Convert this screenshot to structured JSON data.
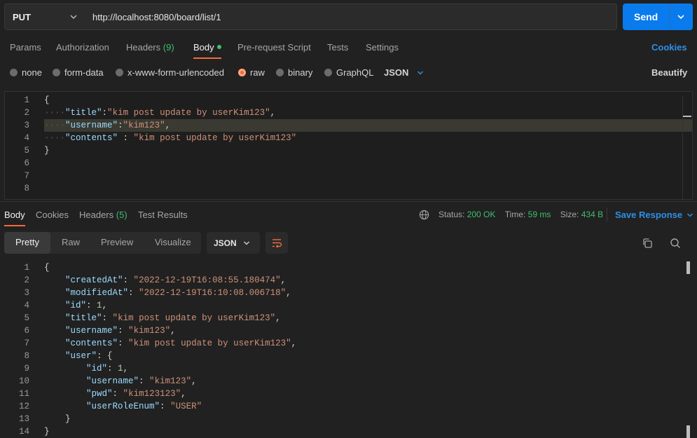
{
  "request": {
    "method": "PUT",
    "url": "http://localhost:8080/board/list/1",
    "send_label": "Send"
  },
  "request_tabs": {
    "params": "Params",
    "authorization": "Authorization",
    "headers": "Headers",
    "headers_count": "(9)",
    "body": "Body",
    "prerequest": "Pre-request Script",
    "tests": "Tests",
    "settings": "Settings",
    "cookies": "Cookies"
  },
  "body_modes": {
    "none": "none",
    "form_data": "form-data",
    "urlencoded": "x-www-form-urlencoded",
    "raw": "raw",
    "binary": "binary",
    "graphql": "GraphQL",
    "format": "JSON",
    "beautify": "Beautify"
  },
  "request_body": {
    "line_numbers": [
      "1",
      "2",
      "3",
      "4",
      "5",
      "6",
      "7",
      "8"
    ],
    "title_value": "kim post update by userKim123",
    "username_value": "kim123",
    "contents_value": "kim post update by userKim123"
  },
  "response_tabs": {
    "body": "Body",
    "cookies": "Cookies",
    "headers": "Headers",
    "headers_count": "(5)",
    "test_results": "Test Results"
  },
  "response_status": {
    "status_label": "Status:",
    "status_value": "200 OK",
    "time_label": "Time:",
    "time_value": "59 ms",
    "size_label": "Size:",
    "size_value": "434 B",
    "save_response": "Save Response"
  },
  "response_view": {
    "pretty": "Pretty",
    "raw": "Raw",
    "preview": "Preview",
    "visualize": "Visualize",
    "format": "JSON"
  },
  "response_body": {
    "line_numbers": [
      "1",
      "2",
      "3",
      "4",
      "5",
      "6",
      "7",
      "8",
      "9",
      "10",
      "11",
      "12",
      "13",
      "14"
    ],
    "createdAt": "2022-12-19T16:08:55.180474",
    "modifiedAt": "2022-12-19T16:10:08.006718",
    "id": "1",
    "title": "kim post update by userKim123",
    "username": "kim123",
    "contents": "kim post update by userKim123",
    "user_id": "1",
    "user_username": "kim123",
    "user_pwd": "kim123123",
    "user_role": "USER"
  },
  "colors": {
    "accent_orange": "#f26b3a",
    "send_blue": "#097bed",
    "status_green": "#3fbf6f"
  }
}
